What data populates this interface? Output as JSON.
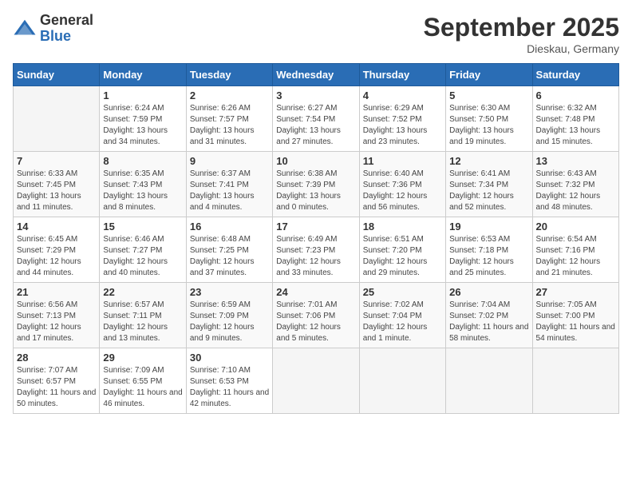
{
  "header": {
    "logo_general": "General",
    "logo_blue": "Blue",
    "month_title": "September 2025",
    "location": "Dieskau, Germany"
  },
  "days_of_week": [
    "Sunday",
    "Monday",
    "Tuesday",
    "Wednesday",
    "Thursday",
    "Friday",
    "Saturday"
  ],
  "weeks": [
    [
      {
        "day": "",
        "sunrise": "",
        "sunset": "",
        "daylight": ""
      },
      {
        "day": "1",
        "sunrise": "Sunrise: 6:24 AM",
        "sunset": "Sunset: 7:59 PM",
        "daylight": "Daylight: 13 hours and 34 minutes."
      },
      {
        "day": "2",
        "sunrise": "Sunrise: 6:26 AM",
        "sunset": "Sunset: 7:57 PM",
        "daylight": "Daylight: 13 hours and 31 minutes."
      },
      {
        "day": "3",
        "sunrise": "Sunrise: 6:27 AM",
        "sunset": "Sunset: 7:54 PM",
        "daylight": "Daylight: 13 hours and 27 minutes."
      },
      {
        "day": "4",
        "sunrise": "Sunrise: 6:29 AM",
        "sunset": "Sunset: 7:52 PM",
        "daylight": "Daylight: 13 hours and 23 minutes."
      },
      {
        "day": "5",
        "sunrise": "Sunrise: 6:30 AM",
        "sunset": "Sunset: 7:50 PM",
        "daylight": "Daylight: 13 hours and 19 minutes."
      },
      {
        "day": "6",
        "sunrise": "Sunrise: 6:32 AM",
        "sunset": "Sunset: 7:48 PM",
        "daylight": "Daylight: 13 hours and 15 minutes."
      }
    ],
    [
      {
        "day": "7",
        "sunrise": "Sunrise: 6:33 AM",
        "sunset": "Sunset: 7:45 PM",
        "daylight": "Daylight: 13 hours and 11 minutes."
      },
      {
        "day": "8",
        "sunrise": "Sunrise: 6:35 AM",
        "sunset": "Sunset: 7:43 PM",
        "daylight": "Daylight: 13 hours and 8 minutes."
      },
      {
        "day": "9",
        "sunrise": "Sunrise: 6:37 AM",
        "sunset": "Sunset: 7:41 PM",
        "daylight": "Daylight: 13 hours and 4 minutes."
      },
      {
        "day": "10",
        "sunrise": "Sunrise: 6:38 AM",
        "sunset": "Sunset: 7:39 PM",
        "daylight": "Daylight: 13 hours and 0 minutes."
      },
      {
        "day": "11",
        "sunrise": "Sunrise: 6:40 AM",
        "sunset": "Sunset: 7:36 PM",
        "daylight": "Daylight: 12 hours and 56 minutes."
      },
      {
        "day": "12",
        "sunrise": "Sunrise: 6:41 AM",
        "sunset": "Sunset: 7:34 PM",
        "daylight": "Daylight: 12 hours and 52 minutes."
      },
      {
        "day": "13",
        "sunrise": "Sunrise: 6:43 AM",
        "sunset": "Sunset: 7:32 PM",
        "daylight": "Daylight: 12 hours and 48 minutes."
      }
    ],
    [
      {
        "day": "14",
        "sunrise": "Sunrise: 6:45 AM",
        "sunset": "Sunset: 7:29 PM",
        "daylight": "Daylight: 12 hours and 44 minutes."
      },
      {
        "day": "15",
        "sunrise": "Sunrise: 6:46 AM",
        "sunset": "Sunset: 7:27 PM",
        "daylight": "Daylight: 12 hours and 40 minutes."
      },
      {
        "day": "16",
        "sunrise": "Sunrise: 6:48 AM",
        "sunset": "Sunset: 7:25 PM",
        "daylight": "Daylight: 12 hours and 37 minutes."
      },
      {
        "day": "17",
        "sunrise": "Sunrise: 6:49 AM",
        "sunset": "Sunset: 7:23 PM",
        "daylight": "Daylight: 12 hours and 33 minutes."
      },
      {
        "day": "18",
        "sunrise": "Sunrise: 6:51 AM",
        "sunset": "Sunset: 7:20 PM",
        "daylight": "Daylight: 12 hours and 29 minutes."
      },
      {
        "day": "19",
        "sunrise": "Sunrise: 6:53 AM",
        "sunset": "Sunset: 7:18 PM",
        "daylight": "Daylight: 12 hours and 25 minutes."
      },
      {
        "day": "20",
        "sunrise": "Sunrise: 6:54 AM",
        "sunset": "Sunset: 7:16 PM",
        "daylight": "Daylight: 12 hours and 21 minutes."
      }
    ],
    [
      {
        "day": "21",
        "sunrise": "Sunrise: 6:56 AM",
        "sunset": "Sunset: 7:13 PM",
        "daylight": "Daylight: 12 hours and 17 minutes."
      },
      {
        "day": "22",
        "sunrise": "Sunrise: 6:57 AM",
        "sunset": "Sunset: 7:11 PM",
        "daylight": "Daylight: 12 hours and 13 minutes."
      },
      {
        "day": "23",
        "sunrise": "Sunrise: 6:59 AM",
        "sunset": "Sunset: 7:09 PM",
        "daylight": "Daylight: 12 hours and 9 minutes."
      },
      {
        "day": "24",
        "sunrise": "Sunrise: 7:01 AM",
        "sunset": "Sunset: 7:06 PM",
        "daylight": "Daylight: 12 hours and 5 minutes."
      },
      {
        "day": "25",
        "sunrise": "Sunrise: 7:02 AM",
        "sunset": "Sunset: 7:04 PM",
        "daylight": "Daylight: 12 hours and 1 minute."
      },
      {
        "day": "26",
        "sunrise": "Sunrise: 7:04 AM",
        "sunset": "Sunset: 7:02 PM",
        "daylight": "Daylight: 11 hours and 58 minutes."
      },
      {
        "day": "27",
        "sunrise": "Sunrise: 7:05 AM",
        "sunset": "Sunset: 7:00 PM",
        "daylight": "Daylight: 11 hours and 54 minutes."
      }
    ],
    [
      {
        "day": "28",
        "sunrise": "Sunrise: 7:07 AM",
        "sunset": "Sunset: 6:57 PM",
        "daylight": "Daylight: 11 hours and 50 minutes."
      },
      {
        "day": "29",
        "sunrise": "Sunrise: 7:09 AM",
        "sunset": "Sunset: 6:55 PM",
        "daylight": "Daylight: 11 hours and 46 minutes."
      },
      {
        "day": "30",
        "sunrise": "Sunrise: 7:10 AM",
        "sunset": "Sunset: 6:53 PM",
        "daylight": "Daylight: 11 hours and 42 minutes."
      },
      {
        "day": "",
        "sunrise": "",
        "sunset": "",
        "daylight": ""
      },
      {
        "day": "",
        "sunrise": "",
        "sunset": "",
        "daylight": ""
      },
      {
        "day": "",
        "sunrise": "",
        "sunset": "",
        "daylight": ""
      },
      {
        "day": "",
        "sunrise": "",
        "sunset": "",
        "daylight": ""
      }
    ]
  ]
}
